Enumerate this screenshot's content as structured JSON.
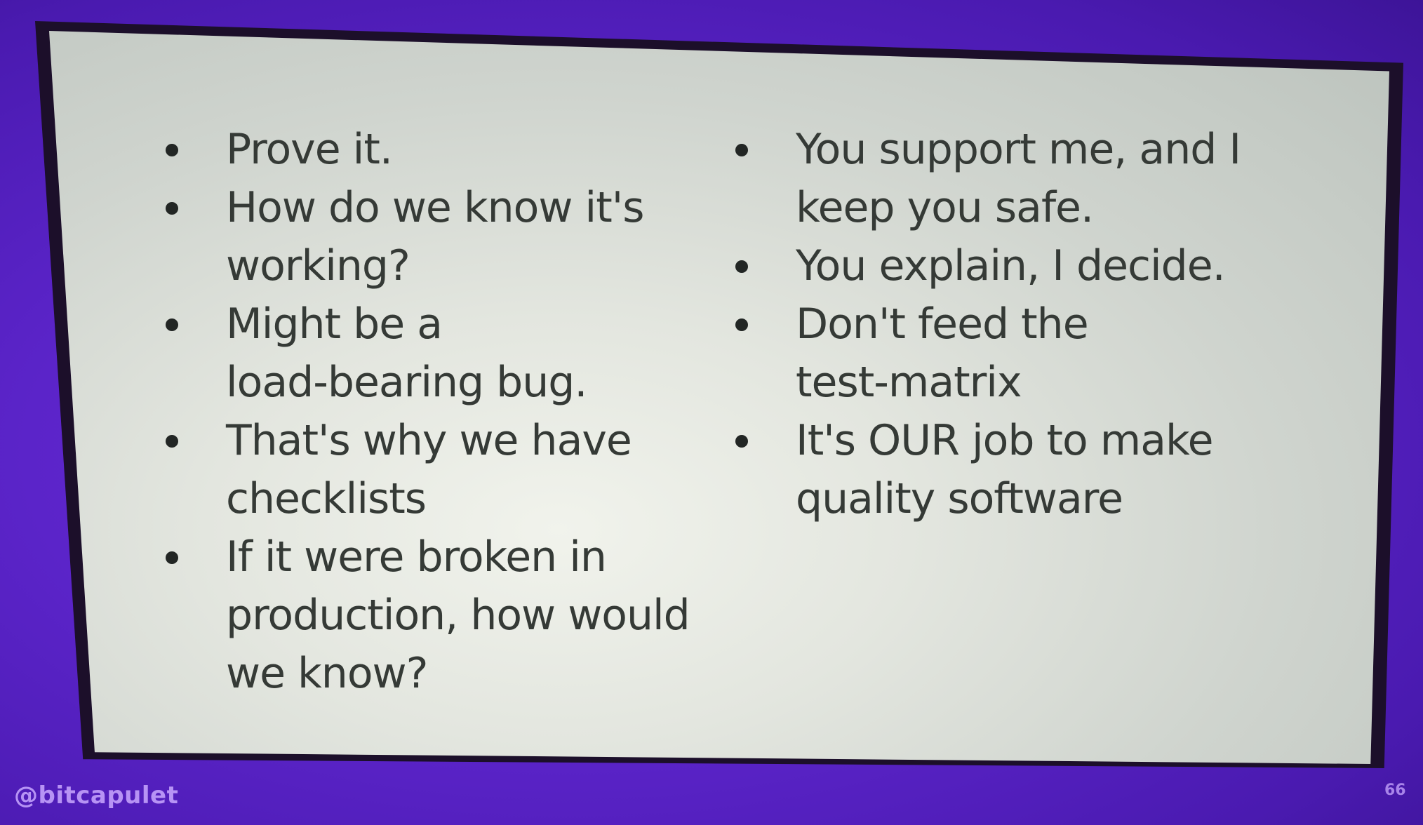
{
  "slide": {
    "left_column": [
      "Prove it.",
      "How do we know it's\nworking?",
      "Might be a\nload-bearing bug.",
      "That's why we have\nchecklists",
      "If it were broken in\nproduction, how would\nwe know?"
    ],
    "right_column": [
      "You support me, and I\nkeep you safe.",
      "You explain, I decide.",
      "Don't feed the\ntest-matrix",
      "It's OUR job to make\nquality software"
    ]
  },
  "footer": {
    "handle": "@bitcapulet",
    "page_number": "66"
  },
  "colors": {
    "background_purple": "#5b24c9",
    "slide_surface": "#e3e6df",
    "text": "#353a36",
    "footer_text": "#c9a8ff"
  }
}
